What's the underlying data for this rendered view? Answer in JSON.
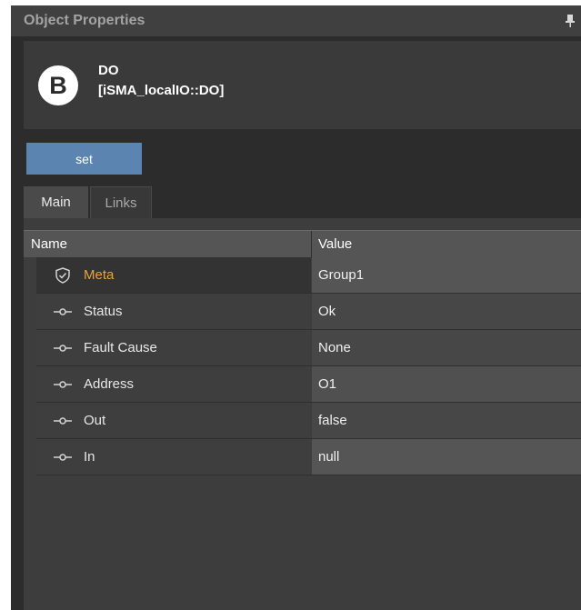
{
  "panel": {
    "title": "Object Properties"
  },
  "object": {
    "badge": "B",
    "name": "DO",
    "type": "[iSMA_localIO::DO]"
  },
  "actions": {
    "set_label": "set"
  },
  "tabs": [
    {
      "label": "Main",
      "active": true
    },
    {
      "label": "Links",
      "active": false
    }
  ],
  "table": {
    "headers": {
      "name": "Name",
      "value": "Value"
    },
    "rows": [
      {
        "icon": "shield-check-icon",
        "name": "Meta",
        "value": "Group1"
      },
      {
        "icon": "slot-pin-icon",
        "name": "Status",
        "value": "Ok"
      },
      {
        "icon": "slot-pin-icon",
        "name": "Fault Cause",
        "value": "None"
      },
      {
        "icon": "slot-pin-icon",
        "name": "Address",
        "value": "O1"
      },
      {
        "icon": "slot-pin-icon",
        "name": "Out",
        "value": "false"
      },
      {
        "icon": "slot-pin-icon",
        "name": "In",
        "value": "null"
      }
    ]
  },
  "colors": {
    "panel_bg": "#2c2c2c",
    "accent_button": "#5b84b1",
    "meta_label": "#e8a33d"
  }
}
